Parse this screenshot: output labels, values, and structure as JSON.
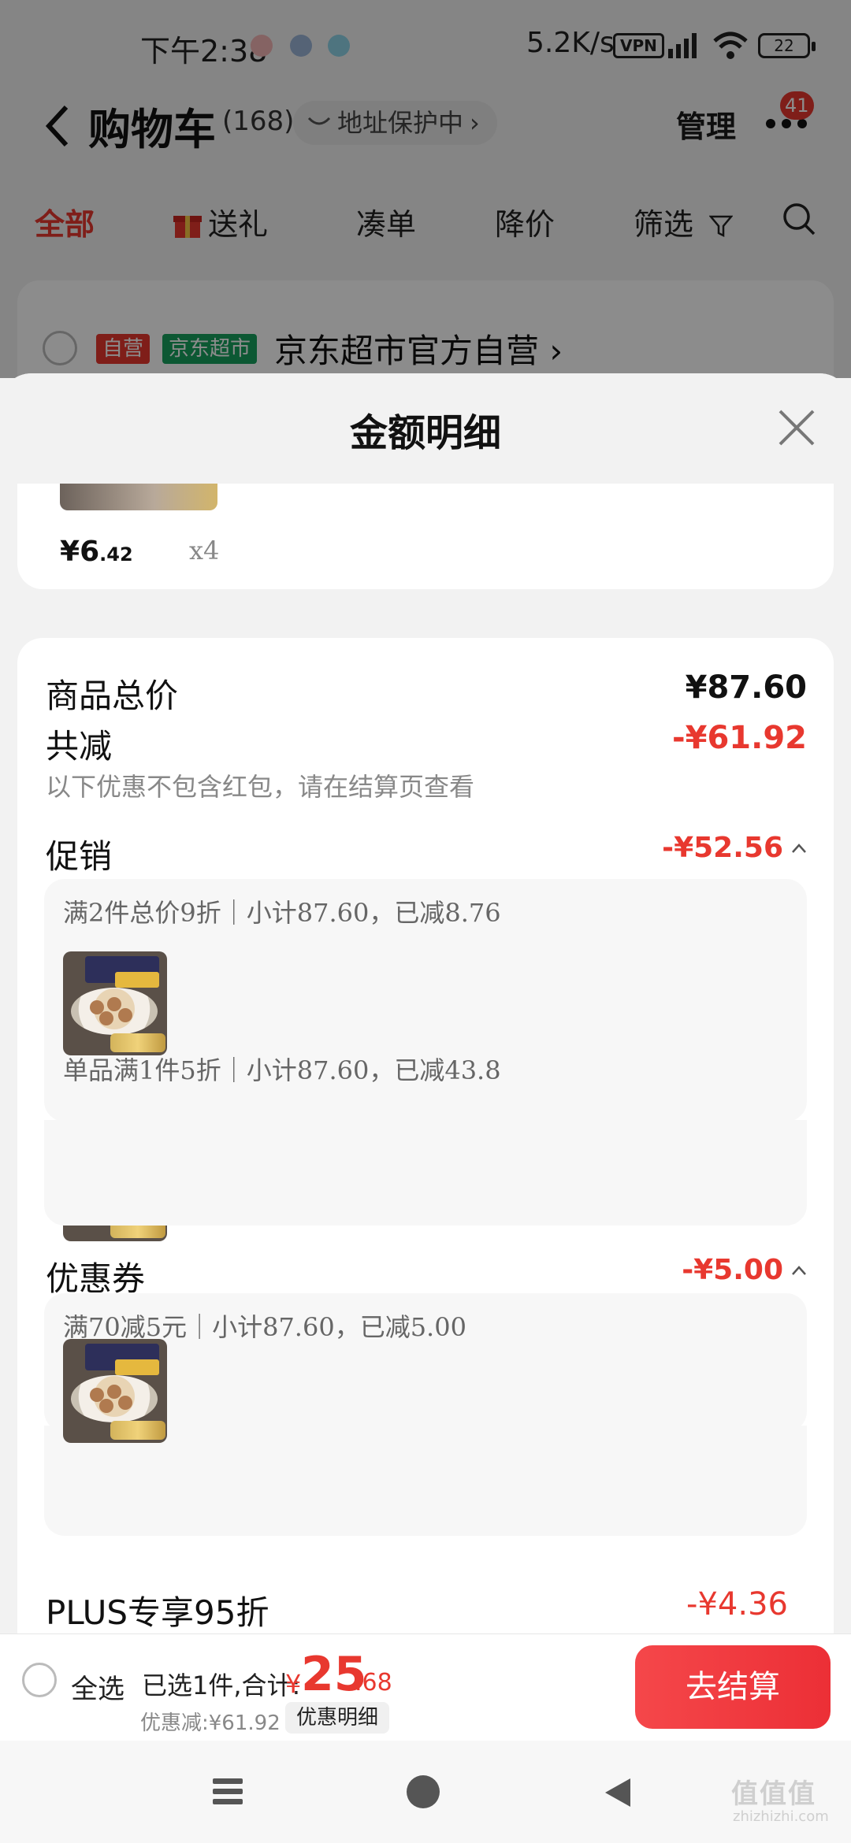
{
  "status_bar": {
    "time": "下午2:38",
    "net_speed": "5.2K/s",
    "vpn": "VPN",
    "battery": "22"
  },
  "header": {
    "title": "购物车",
    "count": "(168)",
    "address_text": "地址保护中",
    "manage_label": "管理",
    "more_badge": "41"
  },
  "filter_tabs": [
    "全部",
    "送礼",
    "凑单",
    "降价",
    "筛选"
  ],
  "store": {
    "tag_self": "自营",
    "tag_super": "京东超市",
    "name": "京东超市官方自营"
  },
  "sheet": {
    "title": "金额明细",
    "prev_item": {
      "price_symbol": "¥",
      "price_int": "6",
      "price_dec": ".42",
      "qty": "x4"
    },
    "goods_total_label": "商品总价",
    "goods_total_value": "¥87.60",
    "total_reduce_label": "共减",
    "total_reduce_value": "-¥61.92",
    "total_reduce_note": "以下优惠不包含红包，请在结算页查看",
    "promo_label": "促销",
    "promo_value": "-¥52.56",
    "promo_lines": [
      "满2件总价9折｜小计87.60，已减8.76",
      "单品满1件5折｜小计87.60，已减43.8"
    ],
    "coupon_label": "优惠券",
    "coupon_value": "-¥5.00",
    "coupon_line": "满70减5元｜小计87.60，已减5.00",
    "plus_label_partial": "PLUS专享95折",
    "plus_value_partial": "-¥4.36"
  },
  "checkout": {
    "select_all": "全选",
    "selected_text": "已选1件,合计:",
    "total_symbol": "¥",
    "total_int": "25",
    "total_dec": ".68",
    "discount_text": "优惠减:¥61.92",
    "discount_detail_button": "优惠明细",
    "checkout_button": "去结算"
  },
  "watermark": {
    "text": "值值值",
    "sub": "zhizhizhi.com"
  },
  "colors": {
    "accent_red": "#e8382f",
    "green_tag": "#17a05d"
  }
}
